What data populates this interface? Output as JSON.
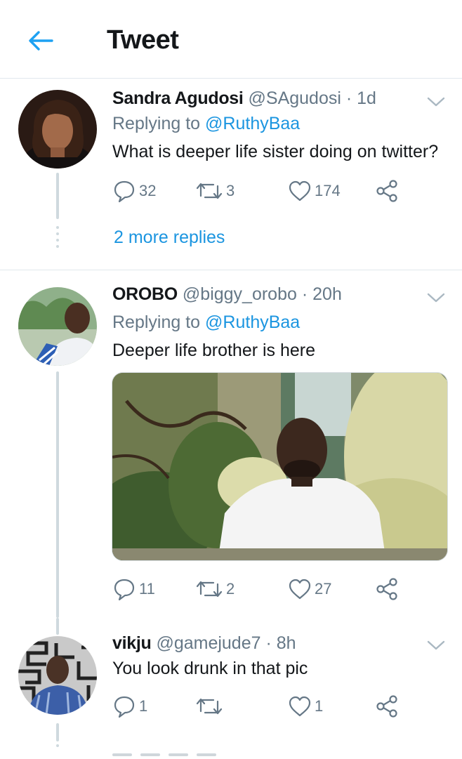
{
  "header": {
    "title": "Tweet",
    "back_icon": "arrow-left-icon",
    "accent": "#1da1f2"
  },
  "tweets": [
    {
      "name": "Sandra Agudosi",
      "handle": "@SAgudosi",
      "separator": "·",
      "time": "1d",
      "replying_prefix": "Replying to ",
      "replying_to": "@RuthyBaa",
      "text": "What is deeper life sister doing on twitter?",
      "replies": "32",
      "retweets": "3",
      "likes": "174",
      "more_replies": "2 more replies"
    },
    {
      "name": "OROBO",
      "handle": "@biggy_orobo",
      "separator": "·",
      "time": "20h",
      "replying_prefix": "Replying to ",
      "replying_to": "@RuthyBaa",
      "text": "Deeper life brother is here",
      "replies": "11",
      "retweets": "2",
      "likes": "27"
    },
    {
      "name": "vikju",
      "handle": "@gamejude7",
      "separator": "·",
      "time": "8h",
      "text": "You look drunk in that pic",
      "replies": "1",
      "retweets": "",
      "likes": "1"
    }
  ],
  "icons": {
    "reply": "reply-icon",
    "retweet": "retweet-icon",
    "like": "heart-icon",
    "share": "share-icon",
    "menu": "chevron-down-icon"
  },
  "colors": {
    "link": "#1b95e0",
    "muted": "#657786",
    "text": "#14171a",
    "divider": "#e1e8ed"
  }
}
